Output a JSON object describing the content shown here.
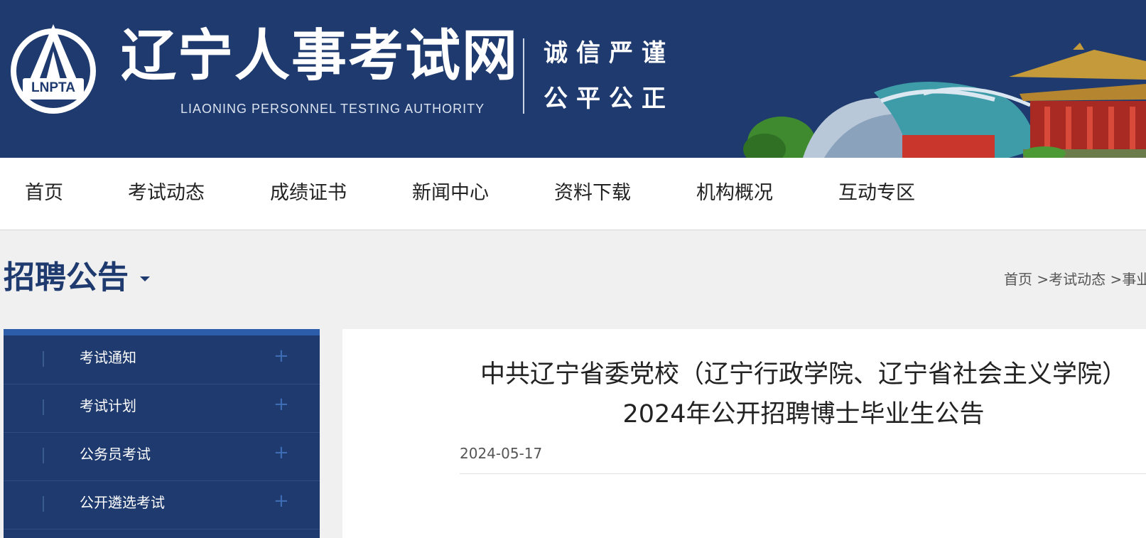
{
  "header": {
    "logo_text": "LNPTA",
    "site_title": "辽宁人事考试网",
    "site_subtitle": "LIAONING PERSONNEL TESTING AUTHORITY",
    "motto_line1": "诚信严谨",
    "motto_line2": "公平公正"
  },
  "nav": {
    "items": [
      {
        "label": "首页"
      },
      {
        "label": "考试动态"
      },
      {
        "label": "成绩证书"
      },
      {
        "label": "新闻中心"
      },
      {
        "label": "资料下载"
      },
      {
        "label": "机构概况"
      },
      {
        "label": "互动专区"
      }
    ]
  },
  "section": {
    "title": "招聘公告",
    "breadcrumb": [
      "首页",
      ">考试动态",
      ">事业"
    ]
  },
  "sidebar": {
    "items": [
      {
        "label": "考试通知",
        "icon": "plus-icon"
      },
      {
        "label": "考试计划",
        "icon": "plus-icon"
      },
      {
        "label": "公务员考试",
        "icon": "plus-icon"
      },
      {
        "label": "公开遴选考试",
        "icon": "plus-icon"
      }
    ]
  },
  "article": {
    "title_line1": "中共辽宁省委党校（辽宁行政学院、辽宁省社会主义学院）",
    "title_line2": "2024年公开招聘博士毕业生公告",
    "date": "2024-05-17"
  },
  "colors": {
    "brand_navy": "#1e3a6e",
    "sidebar_accent": "#2c5dab",
    "plus_icon": "#3e6cb3"
  }
}
